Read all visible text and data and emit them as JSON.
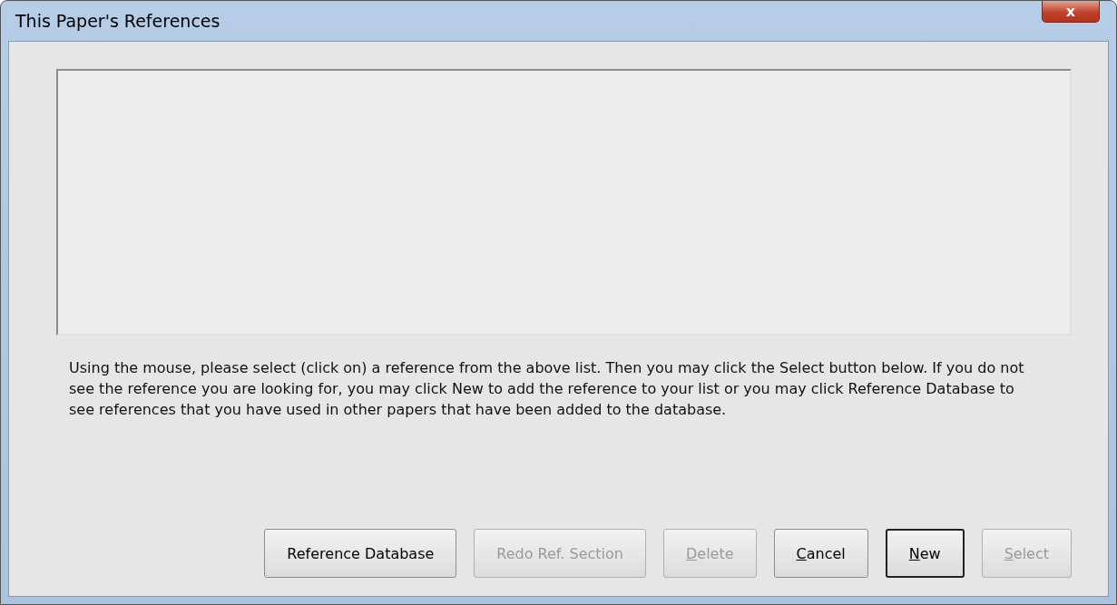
{
  "window": {
    "title": "This Paper's References",
    "close_label": "x"
  },
  "instructions": "Using the mouse, please select (click on) a reference from the above list. Then you may click the Select button below. If you do not see the reference you are looking for, you may click New to add the reference to your list or you may click Reference Database to see references that you have used in other papers that have been added to the database.",
  "buttons": [
    {
      "label": "Reference Database",
      "disabled": false,
      "default": false,
      "mnemonic": false
    },
    {
      "label": "Redo Ref. Section",
      "disabled": true,
      "default": false,
      "mnemonic": false
    },
    {
      "label": "Delete",
      "disabled": true,
      "default": false,
      "mnemonic": true
    },
    {
      "label": "Cancel",
      "disabled": false,
      "default": false,
      "mnemonic": true
    },
    {
      "label": "New",
      "disabled": false,
      "default": true,
      "mnemonic": true
    },
    {
      "label": "Select",
      "disabled": true,
      "default": false,
      "mnemonic": true
    }
  ]
}
